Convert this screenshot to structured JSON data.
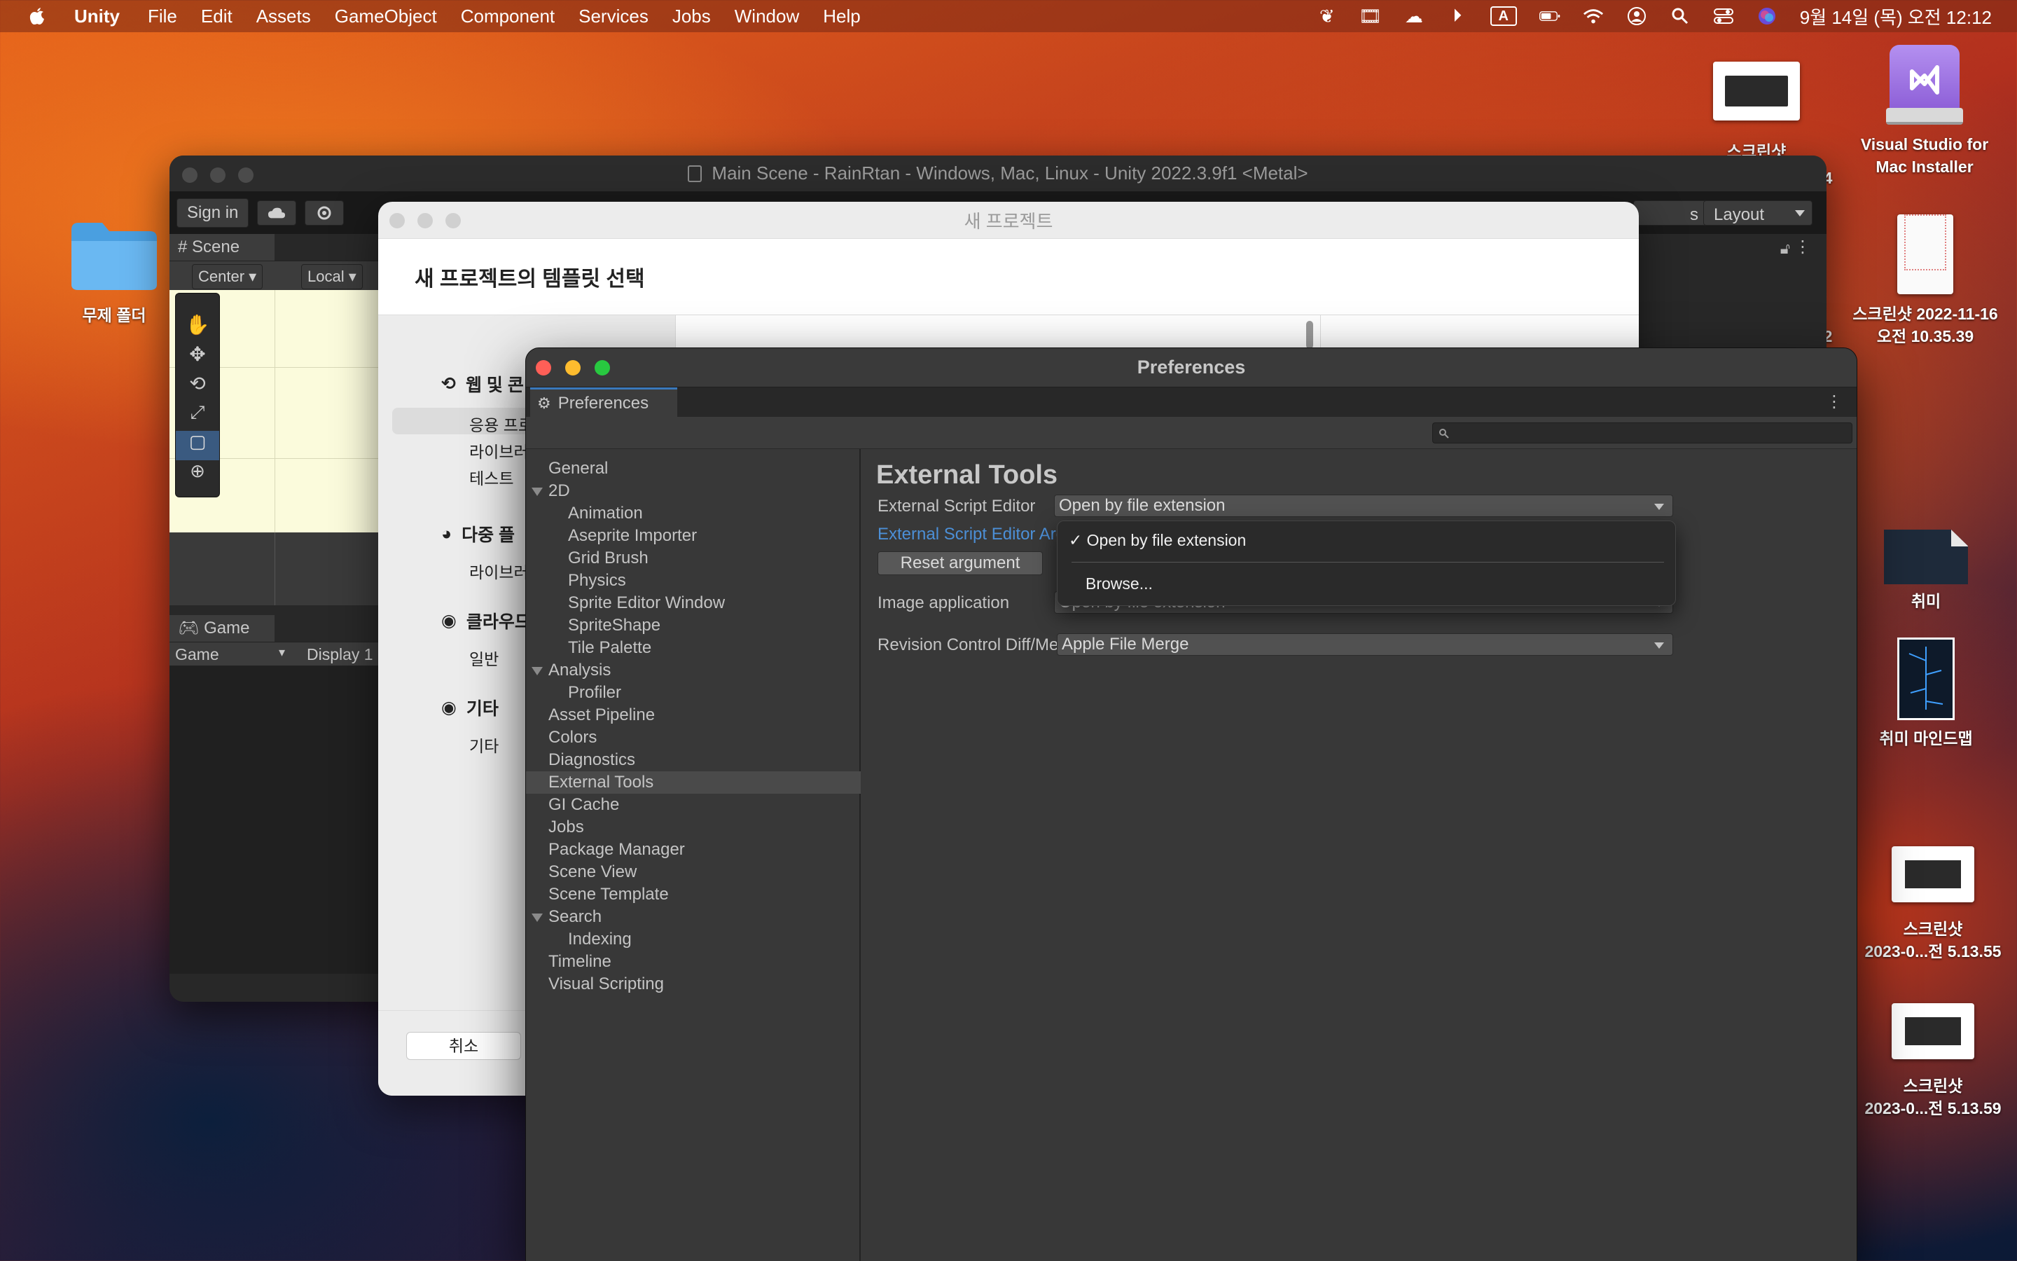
{
  "menubar": {
    "app": "Unity",
    "items": [
      "File",
      "Edit",
      "Assets",
      "GameObject",
      "Component",
      "Services",
      "Jobs",
      "Window",
      "Help"
    ],
    "input_badge": "A",
    "clock": "9월 14일 (목) 오전 12:12"
  },
  "desktop": {
    "folder_label": "무제 폴더",
    "vs_label_1": "Visual Studio for",
    "vs_label_2": "Mac Installer",
    "top_screenshot_label": "스크린샷",
    "top_screenshot_suffix": "4",
    "ss_2022_label_1": "스크린샷 2022-11-16",
    "ss_2022_label_2": "오전 10.35.39",
    "hobby_label": "취미",
    "hobby_map_label": "취미 마인드맵",
    "ss_a_label_1": "스크린샷",
    "ss_a_label_2": "2023-0...전 5.13.55",
    "ss_b_label_1": "스크린샷",
    "ss_b_label_2": "2023-0...전 5.13.59",
    "edge_char": "2"
  },
  "unity": {
    "title": "Main Scene - RainRtan - Windows, Mac, Linux - Unity 2022.3.9f1 <Metal>",
    "sign_in": "Sign in",
    "layout": "Layout",
    "layers_partial": "s",
    "scene_tab": "Scene",
    "center": "Center",
    "local": "Local",
    "game_tab": "Game",
    "game_dropdown": "Game",
    "display": "Display 1"
  },
  "new_project": {
    "window_title": "새 프로젝트",
    "header": "새 프로젝트의 템플릿 선택",
    "sections": [
      {
        "title": "웹 및 콘",
        "items": [
          "응용 프로",
          "라이브러i",
          "테스트"
        ]
      },
      {
        "title": "다중 플",
        "items": [
          "라이브러i"
        ]
      },
      {
        "title": "클라우드",
        "items": [
          "일반"
        ]
      },
      {
        "title": "기타",
        "items": [
          "기타"
        ]
      }
    ],
    "cancel": "취소"
  },
  "preferences": {
    "window_title": "Preferences",
    "tab_label": "Preferences",
    "sidebar": [
      {
        "label": "General",
        "level": 0
      },
      {
        "label": "2D",
        "level": 0,
        "expanded": true
      },
      {
        "label": "Animation",
        "level": 1
      },
      {
        "label": "Aseprite Importer",
        "level": 1
      },
      {
        "label": "Grid Brush",
        "level": 1
      },
      {
        "label": "Physics",
        "level": 1
      },
      {
        "label": "Sprite Editor Window",
        "level": 1
      },
      {
        "label": "SpriteShape",
        "level": 1
      },
      {
        "label": "Tile Palette",
        "level": 1
      },
      {
        "label": "Analysis",
        "level": 0,
        "expanded": true
      },
      {
        "label": "Profiler",
        "level": 1
      },
      {
        "label": "Asset Pipeline",
        "level": 0
      },
      {
        "label": "Colors",
        "level": 0
      },
      {
        "label": "Diagnostics",
        "level": 0
      },
      {
        "label": "External Tools",
        "level": 0,
        "selected": true
      },
      {
        "label": "GI Cache",
        "level": 0
      },
      {
        "label": "Jobs",
        "level": 0
      },
      {
        "label": "Package Manager",
        "level": 0
      },
      {
        "label": "Scene View",
        "level": 0
      },
      {
        "label": "Scene Template",
        "level": 0
      },
      {
        "label": "Search",
        "level": 0,
        "expanded": true
      },
      {
        "label": "Indexing",
        "level": 1
      },
      {
        "label": "Timeline",
        "level": 0
      },
      {
        "label": "Visual Scripting",
        "level": 0
      }
    ],
    "section_title": "External Tools",
    "script_editor_label": "External Script Editor",
    "script_editor_value": "Open by file extension",
    "script_args_label": "External Script Editor Args",
    "reset_button": "Reset argument",
    "image_app_label": "Image application",
    "image_app_value": "Open by file extension",
    "revision_label": "Revision Control Diff/Merge",
    "revision_value": "Apple File Merge",
    "popup": {
      "check": "✓",
      "selected_option": "Open by file extension",
      "other_option": "Browse..."
    }
  },
  "colors": {
    "link_blue": "#4c8fd6",
    "selection_blue": "#3a79bb"
  }
}
